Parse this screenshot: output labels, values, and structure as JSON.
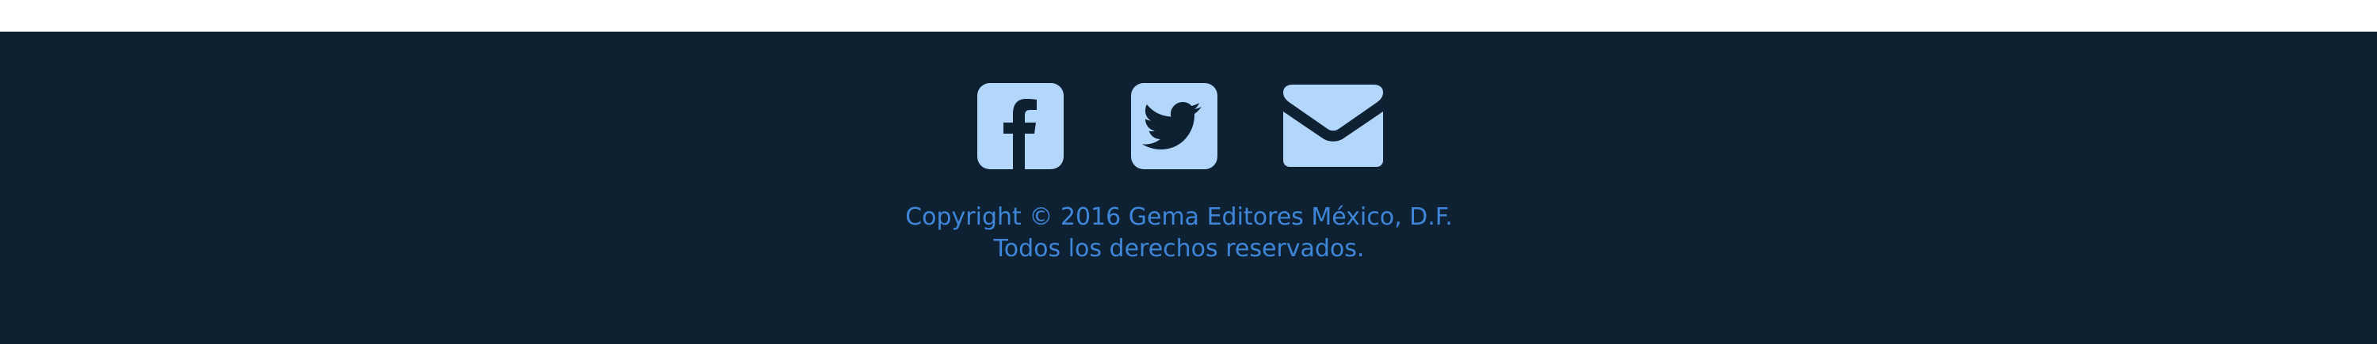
{
  "footer": {
    "background_color": "#0d2133",
    "icon_color": "#b3d6fb",
    "text_color": "#3f86d8",
    "social": [
      {
        "name": "Facebook",
        "icon": "facebook-icon"
      },
      {
        "name": "Twitter",
        "icon": "twitter-icon"
      },
      {
        "name": "Email",
        "icon": "mail-icon"
      }
    ],
    "copyright_line1": "Copyright © 2016 Gema Editores México, D.F.",
    "copyright_line2": "Todos los derechos reservados."
  }
}
